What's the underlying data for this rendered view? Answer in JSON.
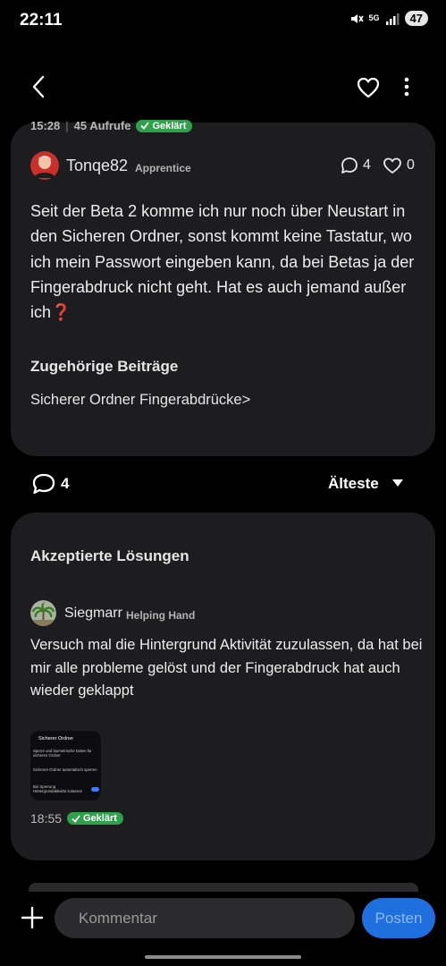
{
  "status_bar": {
    "time": "22:11",
    "network": "5G",
    "battery": "47"
  },
  "post": {
    "time": "15:28",
    "separator": "|",
    "views": "45 Aufrufe",
    "solved_badge": "Geklärt",
    "author": {
      "name": "Tonqe82",
      "rank": "Apprentice"
    },
    "comment_count": "4",
    "like_count": "0",
    "text": "Seit der Beta 2 komme ich nur noch über Neustart in den Sicheren Ordner, sonst kommt keine Tastatur, wo ich mein Passwort eingeben kann, da bei Betas ja der Fingerabdruck nicht geht. Hat es auch jemand außer ich❓",
    "related_title": "Zugehörige Beiträge",
    "related_link": "Sicherer Ordner Fingerabdrücke>"
  },
  "comments_bar": {
    "count": "4",
    "sort": "Älteste"
  },
  "solutions": {
    "title": "Akzeptierte Lösungen",
    "author": {
      "name": "Siegmarr",
      "rank": "Helping Hand"
    },
    "text": "Versuch mal die Hintergrund Aktivität zuzulassen, da hat bei mir alle probleme gelöst und der Fingerabdruck hat auch wieder geklappt",
    "time": "18:55",
    "solved_badge": "Geklärt",
    "thumbnail": {
      "title": "Sicherer Ordner",
      "line1": "Sperre und biometrische Daten für sicheren Ordner",
      "line2": "Sicheren Ordner automatisch sperren",
      "line3": "Bei Sperrung Hintergrundaktivität zulassen"
    }
  },
  "composer": {
    "placeholder": "Kommentar",
    "post_label": "Posten"
  },
  "colors": {
    "card": "#1d1d1f",
    "accent_green": "#2fa14a",
    "post_button": "#1f6fde"
  }
}
